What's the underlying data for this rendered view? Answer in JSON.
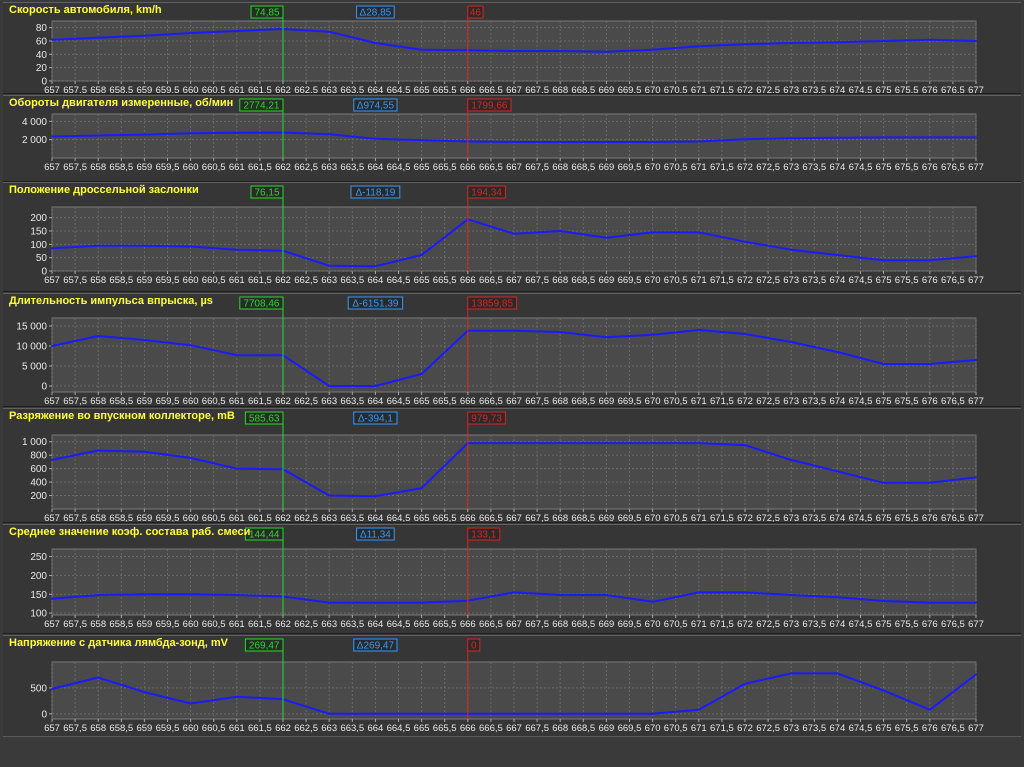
{
  "x_axis": {
    "min": 657,
    "max": 677,
    "step": 0.5,
    "tick_labels": [
      "657",
      "657,5",
      "658",
      "658,5",
      "659",
      "659,5",
      "660",
      "660,5",
      "661",
      "661,5",
      "662",
      "662,5",
      "663",
      "663,5",
      "664",
      "664,5",
      "665",
      "665,5",
      "666",
      "666,5",
      "667",
      "667,5",
      "668",
      "668,5",
      "669",
      "669,5",
      "670",
      "670,5",
      "671",
      "671,5",
      "672",
      "672,5",
      "673",
      "673,5",
      "674",
      "674,5",
      "675",
      "675,5",
      "676",
      "676,5",
      "677"
    ]
  },
  "cursors": {
    "green_x": 662,
    "red_x": 666
  },
  "colors": {
    "background": "#363636",
    "plot_background": "#4a4a4a",
    "grid": "#6a6a6a",
    "line": "#1a1aff",
    "title": "#ffff33",
    "cursor_green": "#22dd22",
    "cursor_red": "#dd2222",
    "delta_blue": "#3399ff"
  },
  "panels": [
    {
      "title": "Скорость автомобиля, km/h",
      "green_value": "74,85",
      "delta_value": "Δ28,85",
      "red_value": "46",
      "chart_data": {
        "type": "line",
        "ylim": [
          0,
          90
        ],
        "y_ticks": [
          0,
          20,
          40,
          60,
          80
        ],
        "y_tick_labels": [
          "0",
          "20",
          "40",
          "60",
          "80"
        ],
        "points": [
          [
            657,
            62
          ],
          [
            658,
            65
          ],
          [
            659,
            68
          ],
          [
            660,
            72
          ],
          [
            661,
            75
          ],
          [
            662,
            78
          ],
          [
            663,
            74
          ],
          [
            664,
            57
          ],
          [
            665,
            47
          ],
          [
            666,
            46
          ],
          [
            667,
            45
          ],
          [
            668,
            45
          ],
          [
            669,
            44
          ],
          [
            670,
            47
          ],
          [
            671,
            52
          ],
          [
            672,
            55
          ],
          [
            673,
            57
          ],
          [
            674,
            58
          ],
          [
            675,
            60
          ],
          [
            676,
            62
          ],
          [
            677,
            60
          ]
        ]
      }
    },
    {
      "title": "Обороты двигателя измеренные, об/мин",
      "green_value": "2774,21",
      "delta_value": "Δ974,55",
      "red_value": "1799,66",
      "chart_data": {
        "type": "line",
        "ylim": [
          0,
          4800
        ],
        "y_ticks": [
          2000,
          4000
        ],
        "y_tick_labels": [
          "2 000",
          "4 000"
        ],
        "points": [
          [
            657,
            2350
          ],
          [
            658,
            2450
          ],
          [
            659,
            2550
          ],
          [
            660,
            2700
          ],
          [
            661,
            2750
          ],
          [
            662,
            2780
          ],
          [
            663,
            2600
          ],
          [
            664,
            2100
          ],
          [
            665,
            1950
          ],
          [
            666,
            1800
          ],
          [
            667,
            1750
          ],
          [
            668,
            1750
          ],
          [
            669,
            1750
          ],
          [
            670,
            1750
          ],
          [
            671,
            1800
          ],
          [
            672,
            2050
          ],
          [
            673,
            2150
          ],
          [
            674,
            2200
          ],
          [
            675,
            2250
          ],
          [
            676,
            2250
          ],
          [
            677,
            2250
          ]
        ]
      }
    },
    {
      "title": "Положение дроссельной заслонки",
      "green_value": "76,15",
      "delta_value": "Δ-118,19",
      "red_value": "194,34",
      "chart_data": {
        "type": "line",
        "ylim": [
          0,
          240
        ],
        "y_ticks": [
          0,
          50,
          100,
          150,
          200
        ],
        "y_tick_labels": [
          "0",
          "50",
          "100",
          "150",
          "200"
        ],
        "points": [
          [
            657,
            85
          ],
          [
            658,
            95
          ],
          [
            659,
            95
          ],
          [
            660,
            92
          ],
          [
            661,
            80
          ],
          [
            662,
            76
          ],
          [
            663,
            20
          ],
          [
            664,
            18
          ],
          [
            665,
            60
          ],
          [
            666,
            194
          ],
          [
            667,
            140
          ],
          [
            668,
            150
          ],
          [
            669,
            125
          ],
          [
            670,
            145
          ],
          [
            671,
            145
          ],
          [
            672,
            110
          ],
          [
            673,
            80
          ],
          [
            674,
            60
          ],
          [
            675,
            40
          ],
          [
            676,
            40
          ],
          [
            677,
            55
          ]
        ]
      }
    },
    {
      "title": "Длительность импульса впрыска, µs",
      "green_value": "7708,46",
      "delta_value": "Δ-6151,39",
      "red_value": "13859,85",
      "chart_data": {
        "type": "line",
        "ylim": [
          -1500,
          17000
        ],
        "y_ticks": [
          0,
          5000,
          10000,
          15000
        ],
        "y_tick_labels": [
          "0",
          "5 000",
          "10 000",
          "15 000"
        ],
        "points": [
          [
            657,
            10000
          ],
          [
            658,
            12500
          ],
          [
            659,
            11500
          ],
          [
            660,
            10200
          ],
          [
            661,
            7700
          ],
          [
            662,
            7708
          ],
          [
            663,
            0
          ],
          [
            664,
            0
          ],
          [
            665,
            3000
          ],
          [
            666,
            13860
          ],
          [
            667,
            13800
          ],
          [
            668,
            13500
          ],
          [
            669,
            12200
          ],
          [
            670,
            12800
          ],
          [
            671,
            14000
          ],
          [
            672,
            13000
          ],
          [
            673,
            11000
          ],
          [
            674,
            8500
          ],
          [
            675,
            5500
          ],
          [
            676,
            5500
          ],
          [
            677,
            6500
          ]
        ]
      }
    },
    {
      "title": "Разряжение во впускном коллекторе, mB",
      "green_value": "585,63",
      "delta_value": "Δ-394,1",
      "red_value": "979,73",
      "chart_data": {
        "type": "line",
        "ylim": [
          0,
          1100
        ],
        "y_ticks": [
          200,
          400,
          600,
          800,
          1000
        ],
        "y_tick_labels": [
          "200",
          "400",
          "600",
          "800",
          "1 000"
        ],
        "points": [
          [
            657,
            730
          ],
          [
            658,
            870
          ],
          [
            659,
            850
          ],
          [
            660,
            760
          ],
          [
            661,
            600
          ],
          [
            662,
            590
          ],
          [
            663,
            200
          ],
          [
            664,
            190
          ],
          [
            665,
            310
          ],
          [
            666,
            980
          ],
          [
            667,
            980
          ],
          [
            668,
            980
          ],
          [
            669,
            980
          ],
          [
            670,
            980
          ],
          [
            671,
            980
          ],
          [
            672,
            950
          ],
          [
            673,
            730
          ],
          [
            674,
            560
          ],
          [
            675,
            390
          ],
          [
            676,
            390
          ],
          [
            677,
            470
          ]
        ]
      }
    },
    {
      "title": "Среднее значение коэф. состава раб. смеси",
      "green_value": "144,44",
      "delta_value": "Δ11,34",
      "red_value": "133,1",
      "chart_data": {
        "type": "line",
        "ylim": [
          95,
          270
        ],
        "y_ticks": [
          100,
          150,
          200,
          250
        ],
        "y_tick_labels": [
          "100",
          "150",
          "200",
          "250"
        ],
        "points": [
          [
            657,
            138
          ],
          [
            658,
            148
          ],
          [
            659,
            150
          ],
          [
            660,
            150
          ],
          [
            661,
            148
          ],
          [
            662,
            144
          ],
          [
            663,
            128
          ],
          [
            664,
            128
          ],
          [
            665,
            128
          ],
          [
            666,
            133
          ],
          [
            667,
            155
          ],
          [
            668,
            148
          ],
          [
            669,
            148
          ],
          [
            670,
            130
          ],
          [
            671,
            155
          ],
          [
            672,
            155
          ],
          [
            673,
            148
          ],
          [
            674,
            142
          ],
          [
            675,
            132
          ],
          [
            676,
            128
          ],
          [
            677,
            128
          ]
        ]
      }
    },
    {
      "title": "Напряжение с датчика лямбда-зонд, mV",
      "green_value": "269,47",
      "delta_value": "Δ269,47",
      "red_value": "0",
      "chart_data": {
        "type": "line",
        "ylim": [
          -100,
          1000
        ],
        "y_ticks": [
          0,
          500
        ],
        "y_tick_labels": [
          "0",
          "500"
        ],
        "points": [
          [
            657,
            480
          ],
          [
            658,
            700
          ],
          [
            659,
            420
          ],
          [
            660,
            200
          ],
          [
            661,
            330
          ],
          [
            662,
            280
          ],
          [
            663,
            0
          ],
          [
            664,
            0
          ],
          [
            665,
            0
          ],
          [
            666,
            0
          ],
          [
            667,
            0
          ],
          [
            668,
            0
          ],
          [
            669,
            0
          ],
          [
            670,
            0
          ],
          [
            671,
            80
          ],
          [
            672,
            580
          ],
          [
            673,
            780
          ],
          [
            674,
            780
          ],
          [
            675,
            450
          ],
          [
            676,
            80
          ],
          [
            677,
            760
          ]
        ]
      }
    }
  ]
}
